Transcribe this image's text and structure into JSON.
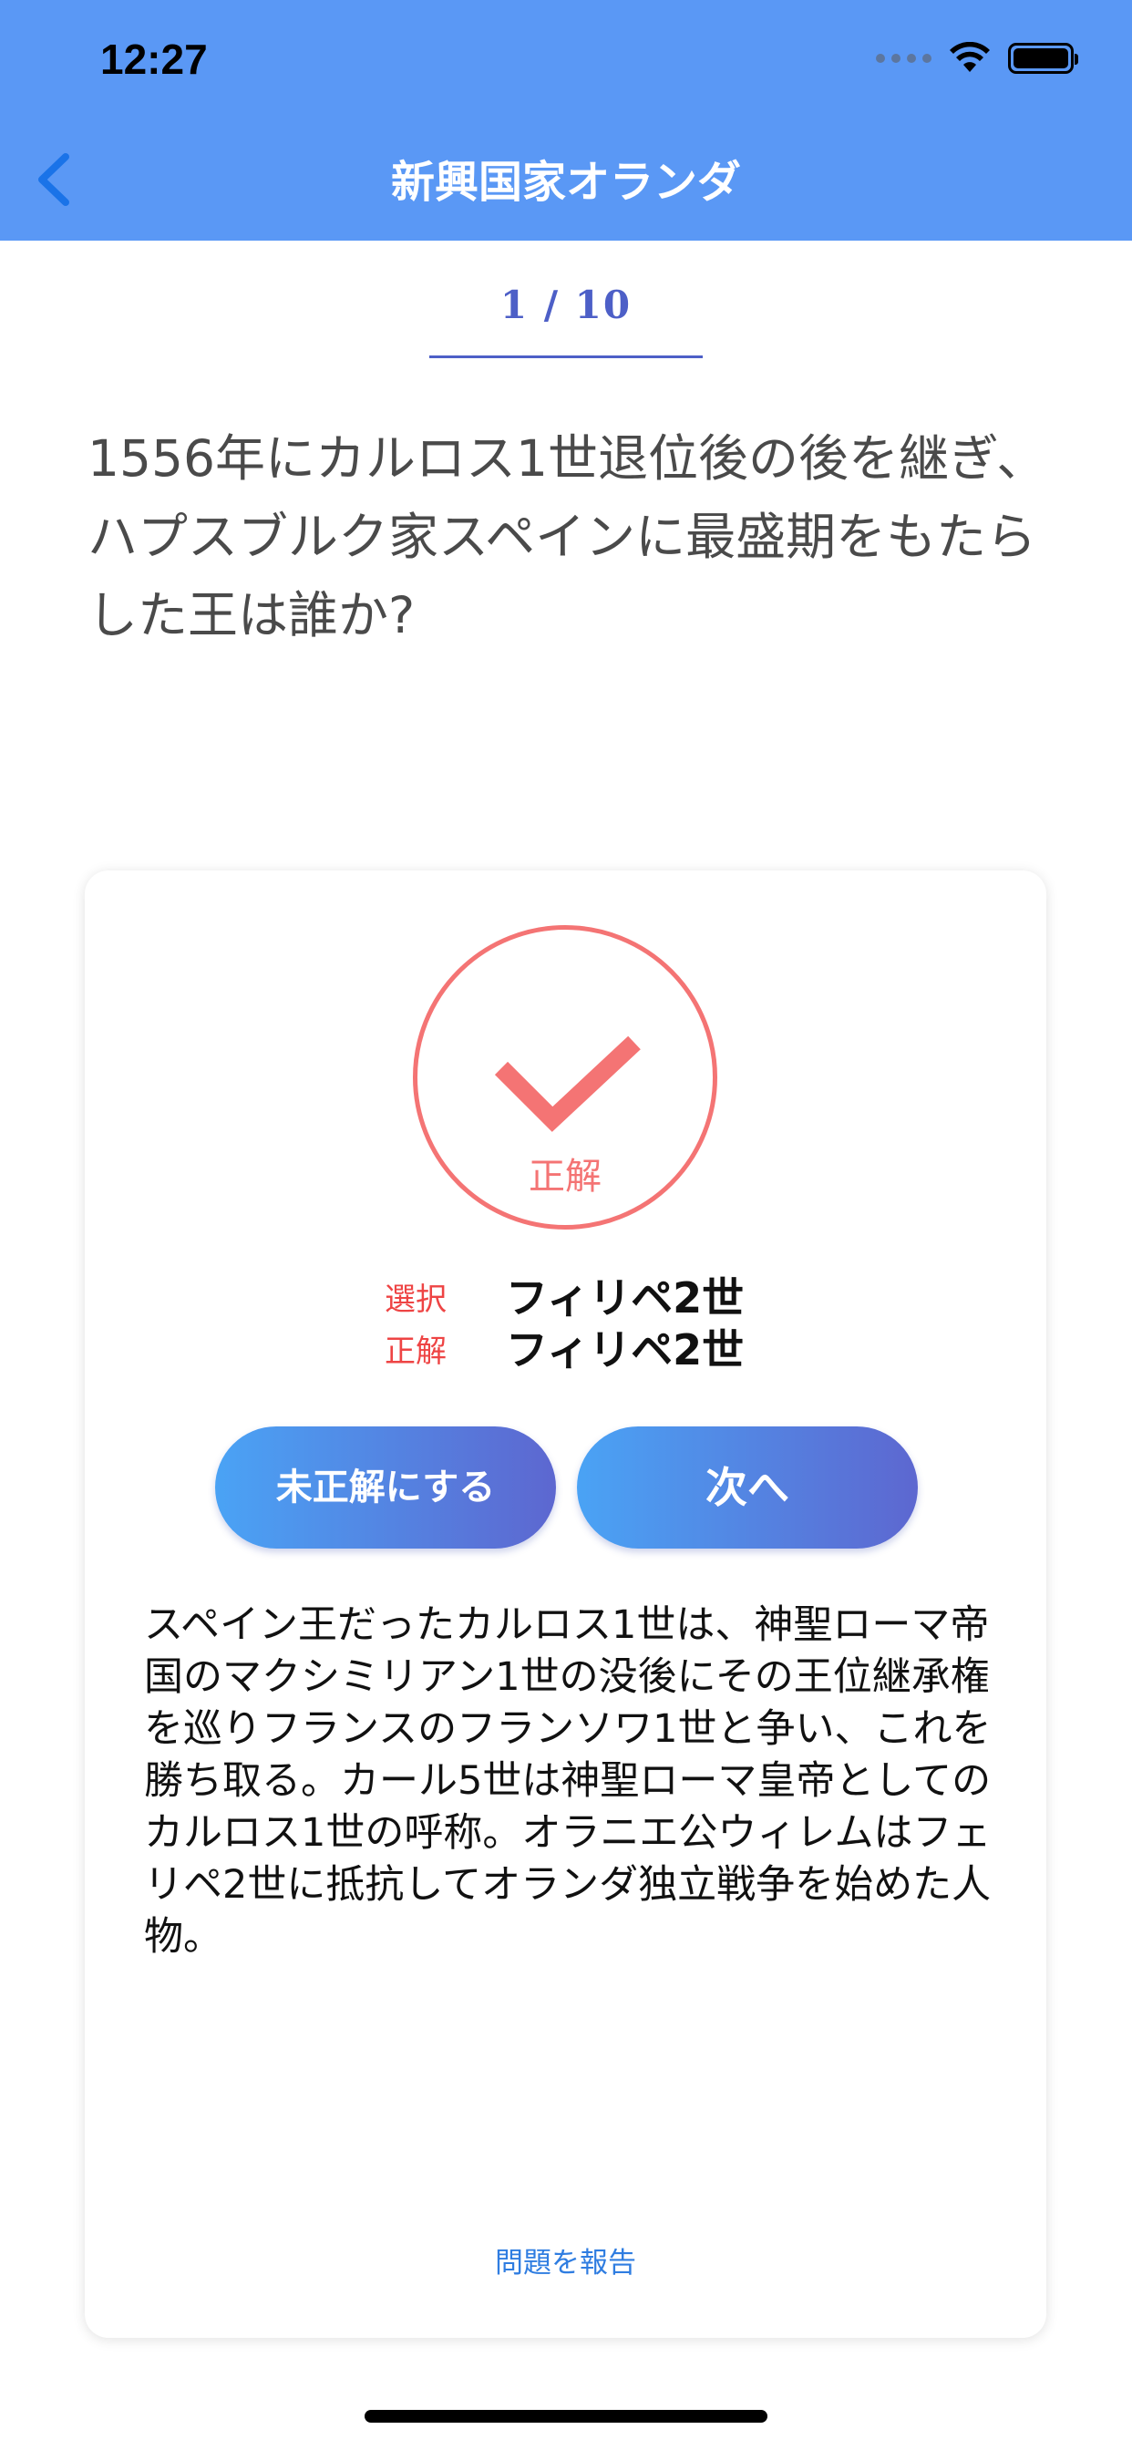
{
  "status_bar": {
    "time": "12:27"
  },
  "nav": {
    "title": "新興国家オランダ",
    "back_icon": "chevron-left-icon"
  },
  "quiz": {
    "progress": "1 / 10",
    "question": "1556年にカルロス1世退位後の後を継ぎ、ハプスブルク家スペインに最盛期をもたらした王は誰か?"
  },
  "result": {
    "status_label": "正解",
    "icon": "check-icon",
    "selected_label": "選択",
    "selected_value": "フィリペ2世",
    "correct_label": "正解",
    "correct_value": "フィリペ2世"
  },
  "buttons": {
    "mark_incorrect": "未正解にする",
    "next": "次へ"
  },
  "explanation": "スペイン王だったカルロス1世は、神聖ローマ帝国のマクシミリアン1世の没後にその王位継承権を巡りフランスのフランソワ1世と争い、これを勝ち取る。カール5世は神聖ローマ皇帝としてのカルロス1世の呼称。オラニエ公ウィレムはフェリペ2世に抵抗してオランダ独立戦争を始めた人物。",
  "report_link": "問題を報告",
  "colors": {
    "header": "#5a98f5",
    "accent": "#4d5fc7",
    "correct": "#f47474",
    "link": "#2f7de1"
  }
}
